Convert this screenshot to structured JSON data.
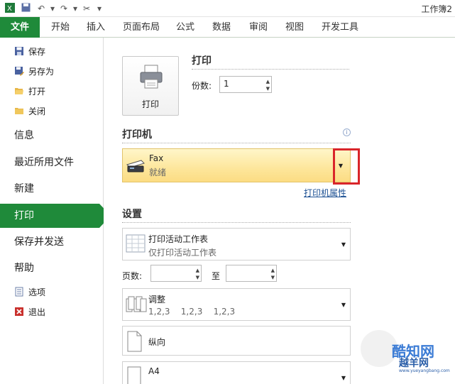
{
  "window": {
    "title": "工作簿2"
  },
  "quick_access": [
    "save-icon",
    "undo-icon",
    "redo-icon",
    "tools-icon",
    "customize-icon"
  ],
  "tabs": [
    {
      "label": "文件",
      "active": true
    },
    {
      "label": "开始"
    },
    {
      "label": "插入"
    },
    {
      "label": "页面布局"
    },
    {
      "label": "公式"
    },
    {
      "label": "数据"
    },
    {
      "label": "审阅"
    },
    {
      "label": "视图"
    },
    {
      "label": "开发工具"
    }
  ],
  "nav": {
    "save": "保存",
    "save_as": "另存为",
    "open": "打开",
    "close": "关闭",
    "info": "信息",
    "recent": "最近所用文件",
    "new": "新建",
    "print": "打印",
    "save_send": "保存并发送",
    "help": "帮助",
    "options": "选项",
    "exit": "退出"
  },
  "print": {
    "section_title": "打印",
    "button_label": "打印",
    "copies_label": "份数:",
    "copies_value": "1"
  },
  "printer": {
    "section_title": "打印机",
    "name": "Fax",
    "status": "就绪",
    "properties_link": "打印机属性"
  },
  "settings": {
    "section_title": "设置",
    "scope_title": "打印活动工作表",
    "scope_sub": "仅打印活动工作表",
    "pages_label": "页数:",
    "to_label": "至",
    "collate_title": "调整",
    "collate_sub": "1,2,3    1,2,3    1,2,3",
    "orientation": "纵向",
    "paper_size": "A4"
  },
  "watermark": {
    "line1": "酷知网",
    "line2": "越羊网",
    "line3": "www.yueyangbang.com"
  },
  "colors": {
    "accent": "#1f8a3a",
    "highlight_border": "#d9252a",
    "printer_fill": "#fde69b"
  }
}
